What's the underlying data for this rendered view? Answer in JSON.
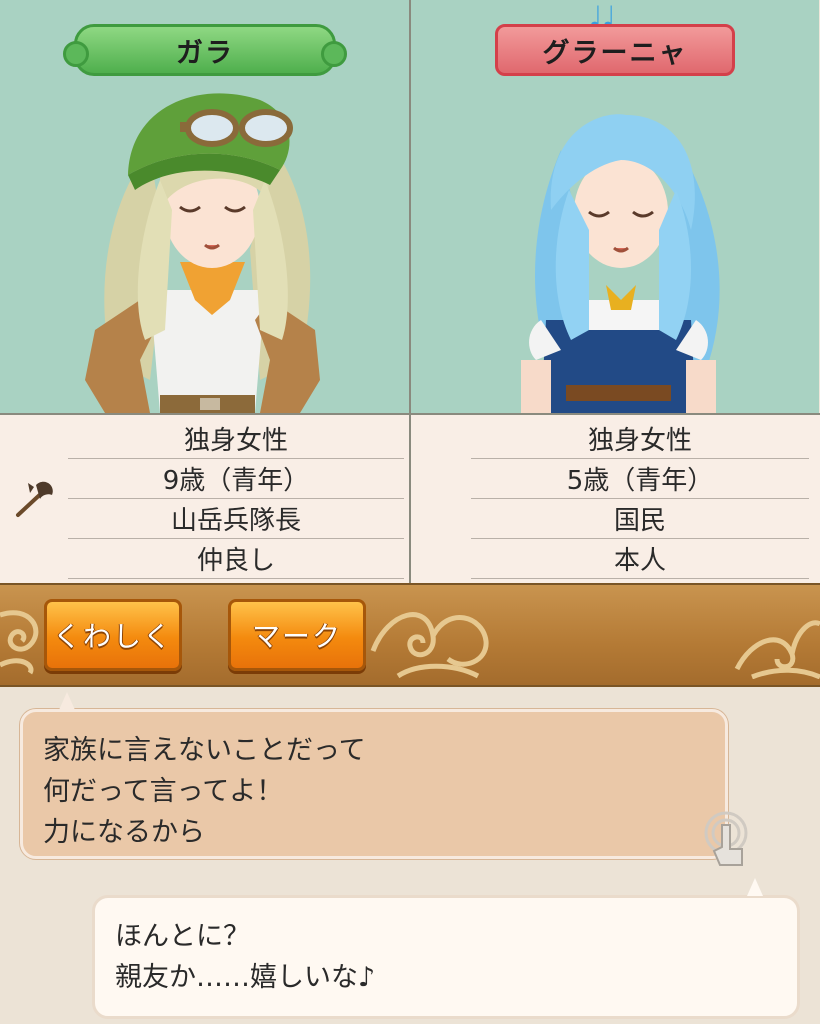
{
  "left_character": {
    "name": "ガラ",
    "info": [
      "独身女性",
      "9歳（青年）",
      "山岳兵隊長",
      "仲良し"
    ],
    "weapon_icon": "axe-icon"
  },
  "right_character": {
    "name": "グラーニャ",
    "info": [
      "独身女性",
      "5歳（青年）",
      "国民",
      "本人"
    ],
    "status_icon": "music-notes-icon",
    "status_glyph": "♩♩"
  },
  "buttons": {
    "detail_label": "くわしく",
    "mark_label": "マーク"
  },
  "dialogue": {
    "speech_1": [
      "家族に言えないことだって",
      "何だって言ってよ！",
      "力になるから"
    ],
    "speech_2": [
      "ほんとに？",
      "親友か……嬉しいな♪"
    ]
  },
  "colors": {
    "portrait_bg": "#a9d2c2",
    "name_plate_left": "#4faf4d",
    "name_plate_right": "#e0686e",
    "button_orange": "#f48a0e",
    "button_bar_brown": "#b47a35",
    "speech_left_bg": "#eac8a8",
    "speech_right_bg": "#fff9f2"
  }
}
